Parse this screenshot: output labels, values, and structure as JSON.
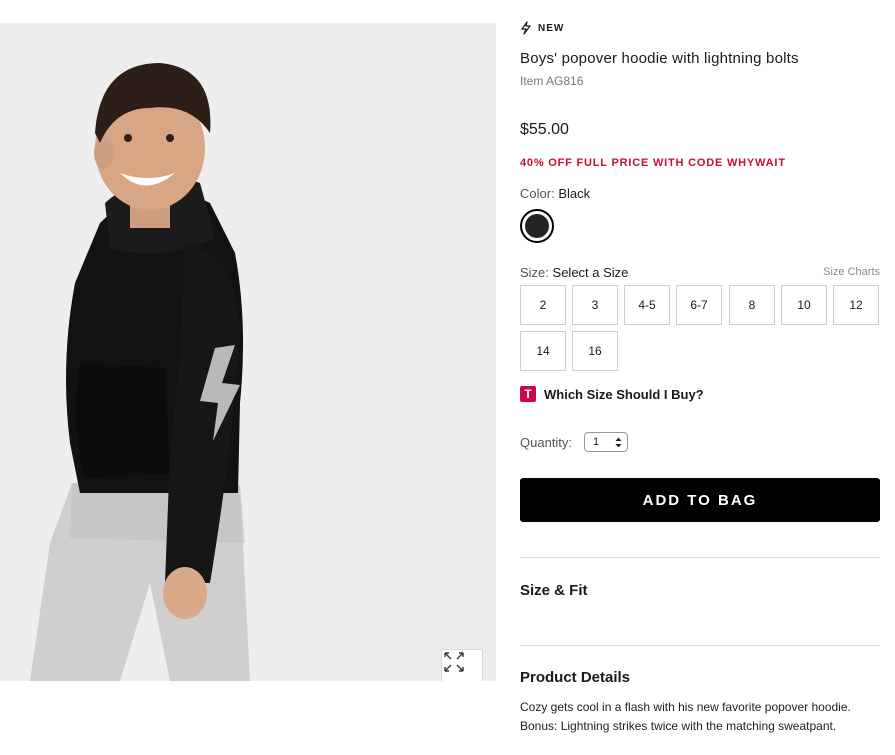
{
  "product": {
    "badge": "NEW",
    "title": "Boys' popover hoodie with lightning bolts",
    "item_number": "Item AG816",
    "price": "$55.00",
    "promo": "40% OFF FULL PRICE WITH CODE WHYWAIT"
  },
  "color": {
    "label": "Color:",
    "value": "Black",
    "swatch_hex": "#242424"
  },
  "size": {
    "label": "Size:",
    "value": "Select a Size",
    "charts_link": "Size Charts",
    "options": [
      "2",
      "3",
      "4-5",
      "6-7",
      "8",
      "10",
      "12",
      "14",
      "16"
    ]
  },
  "fit_help": {
    "icon_letter": "T",
    "label": "Which Size Should I Buy?"
  },
  "quantity": {
    "label": "Quantity:",
    "value": "1"
  },
  "actions": {
    "add_to_bag": "ADD TO BAG"
  },
  "sections": {
    "size_fit": "Size & Fit",
    "product_details": "Product Details",
    "details_text": "Cozy gets cool in a flash with his new favorite popover hoodie. Bonus: Lightning strikes twice with the matching sweatpant."
  },
  "colors": {
    "promo_red": "#c8102e",
    "button_black": "#000000",
    "fit_icon": "#d6004f"
  }
}
